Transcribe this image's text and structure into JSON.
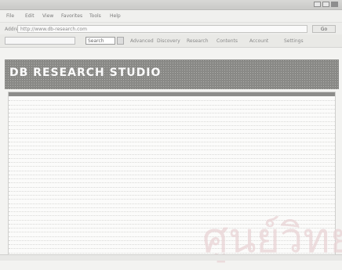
{
  "window": {
    "title": ""
  },
  "menu": [
    "File",
    "Edit",
    "View",
    "Favorites",
    "Tools",
    "Help"
  ],
  "address": {
    "label": "Address",
    "url": "http://www.db-research.com",
    "go": "Go"
  },
  "links": {
    "select": "",
    "search_value": "Search",
    "items": [
      "Advanced",
      "Discovery",
      "Research",
      "Contents",
      "Account",
      "Settings"
    ]
  },
  "banner": {
    "title": "DB RESEARCH STUDIO",
    "subtitle": ""
  },
  "results": {
    "rows": [
      {
        "text": "",
        "link": "",
        "marker": ""
      },
      {
        "text": "",
        "link": "",
        "marker": ""
      },
      {
        "text": "",
        "link": "",
        "marker": ""
      },
      {
        "text": "",
        "link": "",
        "marker": ""
      },
      {
        "text": "",
        "link": "",
        "marker": ""
      },
      {
        "text": "",
        "link": "",
        "marker": ""
      },
      {
        "text": "",
        "link": "",
        "marker": ""
      },
      {
        "text": "",
        "link": "",
        "marker": ""
      },
      {
        "text": "",
        "link": "",
        "marker": ""
      },
      {
        "text": "",
        "link": "",
        "marker": ""
      },
      {
        "text": "",
        "link": "",
        "marker": ""
      },
      {
        "text": "",
        "link": "",
        "marker": ""
      },
      {
        "text": "",
        "link": "",
        "marker": ""
      },
      {
        "text": "",
        "link": "",
        "marker": ""
      },
      {
        "text": "",
        "link": "",
        "marker": ""
      },
      {
        "text": "",
        "link": "",
        "marker": ""
      },
      {
        "text": "",
        "link": "",
        "marker": ""
      },
      {
        "text": "",
        "link": "",
        "marker": ""
      },
      {
        "text": "",
        "link": "",
        "marker": ""
      },
      {
        "text": "",
        "link": "",
        "marker": ""
      },
      {
        "text": "",
        "link": "",
        "marker": ""
      },
      {
        "text": "",
        "link": "",
        "marker": ""
      },
      {
        "text": "",
        "link": "",
        "marker": ""
      },
      {
        "text": "",
        "link": "",
        "marker": ""
      },
      {
        "text": "",
        "link": "",
        "marker": ""
      },
      {
        "text": "",
        "link": "",
        "marker": ""
      },
      {
        "text": "",
        "link": "",
        "marker": ""
      },
      {
        "text": "",
        "link": "",
        "marker": ""
      },
      {
        "text": "",
        "link": "",
        "marker": ""
      },
      {
        "text": "",
        "link": "",
        "marker": ""
      },
      {
        "text": "",
        "link": "",
        "marker": ""
      },
      {
        "text": "",
        "link": "",
        "marker": ""
      },
      {
        "text": "",
        "link": "",
        "marker": ""
      },
      {
        "text": "",
        "link": "",
        "marker": ""
      },
      {
        "text": "",
        "link": "",
        "marker": ""
      },
      {
        "text": "",
        "link": "",
        "marker": ""
      },
      {
        "text": "",
        "link": "",
        "marker": ""
      },
      {
        "text": "",
        "link": "",
        "marker": ""
      }
    ]
  },
  "watermark": "ศูนย์วิทย",
  "status": {
    "left": "",
    "zone": ""
  },
  "colors": {
    "banner": "#898986",
    "panel_header": "#8c8c8a",
    "watermark": "#e9d3d5"
  }
}
